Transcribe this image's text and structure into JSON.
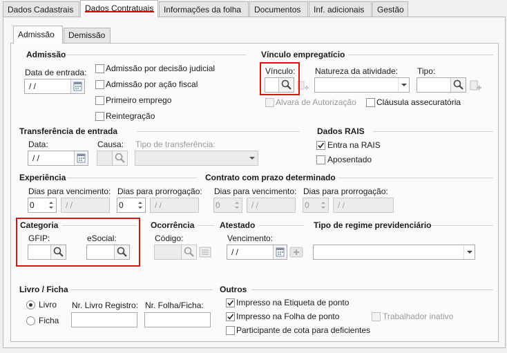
{
  "tabs": [
    {
      "label": "Dados Cadastrais"
    },
    {
      "label": "Dados Contratuais"
    },
    {
      "label": "Informações da folha"
    },
    {
      "label": "Documentos"
    },
    {
      "label": "Inf. adicionais"
    },
    {
      "label": "Gestão"
    }
  ],
  "subtabs": [
    {
      "label": "Admissão"
    },
    {
      "label": "Demissão"
    }
  ],
  "admissao": {
    "header": "Admissão",
    "data_entrada_label": "Data de entrada:",
    "data_entrada_value": " / /",
    "checks": [
      {
        "label": "Admissão por decisão judicial"
      },
      {
        "label": "Admissão por ação fiscal"
      },
      {
        "label": "Primeiro emprego"
      },
      {
        "label": "Reintegração"
      }
    ]
  },
  "vinculo": {
    "header": "Vínculo empregatício",
    "vinculo_label": "Vínculo:",
    "natureza_label": "Natureza da atividade:",
    "tipo_label": "Tipo:",
    "alvara_label": "Alvará de Autorização",
    "clausula_label": "Cláusula assecuratória"
  },
  "transferencia": {
    "header": "Transferência de entrada",
    "data_label": "Data:",
    "data_value": " / /",
    "causa_label": "Causa:",
    "tipo_label": "Tipo de transferência:"
  },
  "rais": {
    "header": "Dados RAIS",
    "entra_label": "Entra na RAIS",
    "aposentado_label": "Aposentado"
  },
  "experiencia": {
    "header": "Experiência",
    "dias_venc_label": "Dias para vencimento:",
    "dias_prorr_label": "Dias para prorrogação:",
    "dias_venc_value": "0",
    "venc_date": " / /",
    "dias_prorr_value": "0",
    "prorr_date": " / /"
  },
  "contrato": {
    "header": "Contrato com prazo determinado",
    "dias_venc_label": "Dias para vencimento:",
    "dias_prorr_label": "Dias para prorrogação:",
    "dias_venc_value": "0",
    "venc_date": " / /",
    "dias_prorr_value": "0",
    "prorr_date": " / /"
  },
  "categoria": {
    "header": "Categoria",
    "gfip_label": "GFIP:",
    "esocial_label": "eSocial:"
  },
  "ocorrencia": {
    "header": "Ocorrência",
    "codigo_label": "Código:"
  },
  "atestado": {
    "header": "Atestado",
    "vencimento_label": "Vencimento:",
    "vencimento_value": " / /"
  },
  "regime": {
    "header": "Tipo de regime previdenciário"
  },
  "livro": {
    "header": "Livro / Ficha",
    "livro_label": "Livro",
    "ficha_label": "Ficha",
    "nr_livro_label": "Nr. Livro Registro:",
    "nr_folha_label": "Nr. Folha/Ficha:"
  },
  "outros": {
    "header": "Outros",
    "impresso_etiqueta_label": "Impresso na Etiqueta de ponto",
    "impresso_folha_label": "Impresso na Folha de ponto",
    "trabalhador_inativo_label": "Trabalhador inativo",
    "participante_label": "Participante de cota para deficientes"
  },
  "colors": {
    "highlight": "#e01010",
    "tab_underline": "#e00000"
  }
}
